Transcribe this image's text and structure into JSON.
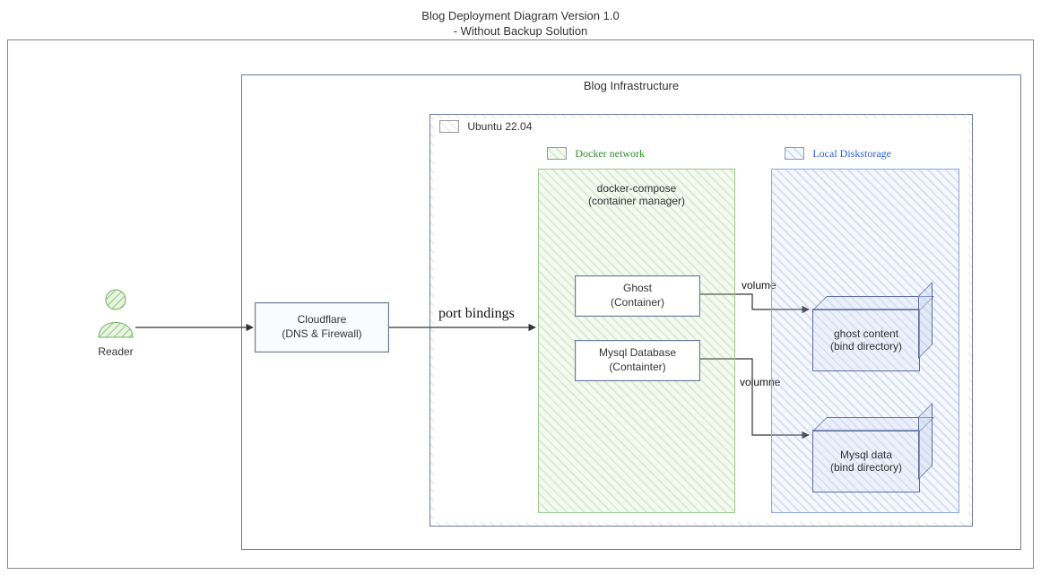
{
  "title": {
    "line1": "Blog Deployment Diagram Version 1.0",
    "line2": "- Without Backup Solution"
  },
  "actor": {
    "label": "Reader"
  },
  "cloudflare": {
    "line1": "Cloudflare",
    "line2": "(DNS & Firewall)"
  },
  "infra": {
    "title": "Blog Infrastructure"
  },
  "ubuntu": {
    "title": "Ubuntu 22.04"
  },
  "docker_net": {
    "title": "Docker network"
  },
  "disk": {
    "title": "Local Diskstorage"
  },
  "compose": {
    "line1": "docker-compose",
    "line2": "(container manager)"
  },
  "ghost": {
    "line1": "Ghost",
    "line2": "(Container)"
  },
  "mysql": {
    "line1": "Mysql Database",
    "line2": "(Containter)"
  },
  "vol_ghost": {
    "line1": "ghost content",
    "line2": "(bind directory)"
  },
  "vol_mysql": {
    "line1": "Mysql data",
    "line2": "(bind directory)"
  },
  "edges": {
    "port": "port bindings",
    "v1": "volume",
    "v2": "volumne"
  }
}
